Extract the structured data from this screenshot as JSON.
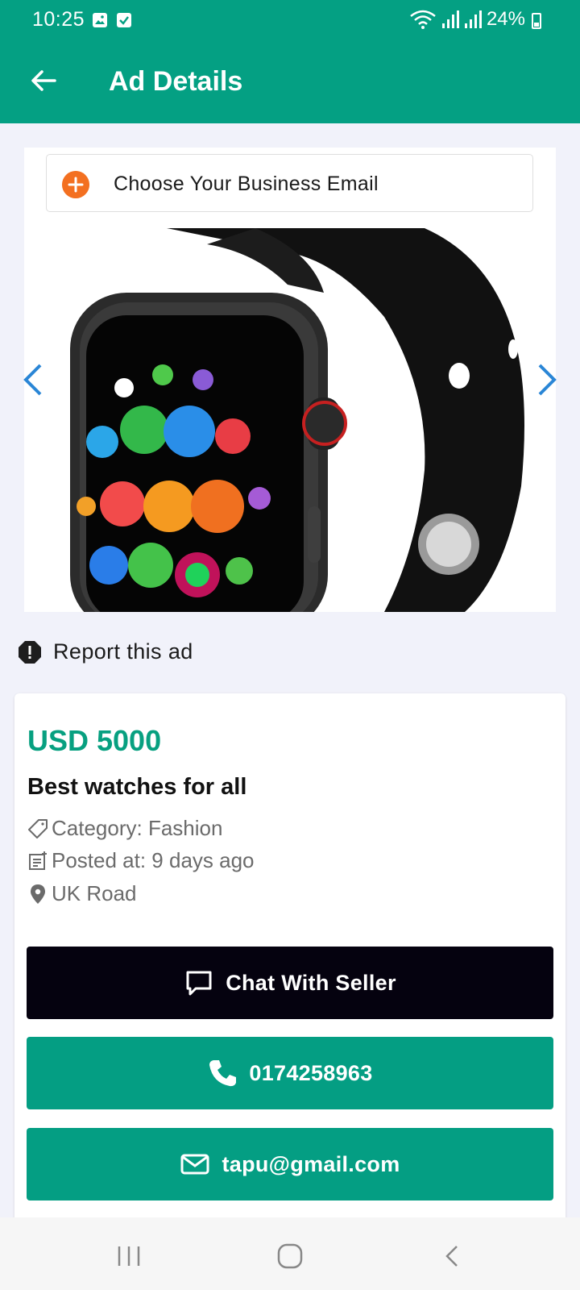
{
  "status_bar": {
    "time": "10:25",
    "battery": "24%"
  },
  "app_bar": {
    "title": "Ad Details"
  },
  "gallery": {
    "business_email_prompt": "Choose Your Business Email"
  },
  "report": {
    "label": "Report this ad"
  },
  "ad": {
    "price": "USD 5000",
    "title": "Best watches for all",
    "category": "Category: Fashion",
    "posted": "Posted at: 9 days ago",
    "location": "UK Road"
  },
  "actions": {
    "chat_label": "Chat With Seller",
    "phone": "0174258963",
    "email": "tapu@gmail.com"
  },
  "colors": {
    "primary": "#04a083",
    "chat_button": "#05020f",
    "accent_orange": "#f37021",
    "arrow_blue": "#2a86d6"
  },
  "icons": [
    "gallery-icon",
    "check-icon",
    "wifi-icon",
    "signal-icon",
    "battery-icon",
    "back-arrow-icon",
    "plus-icon",
    "chevron-left-icon",
    "chevron-right-icon",
    "warning-icon",
    "tag-icon",
    "posted-icon",
    "location-pin-icon",
    "chat-icon",
    "phone-icon",
    "mail-icon",
    "recents-icon",
    "home-icon",
    "back-icon"
  ]
}
